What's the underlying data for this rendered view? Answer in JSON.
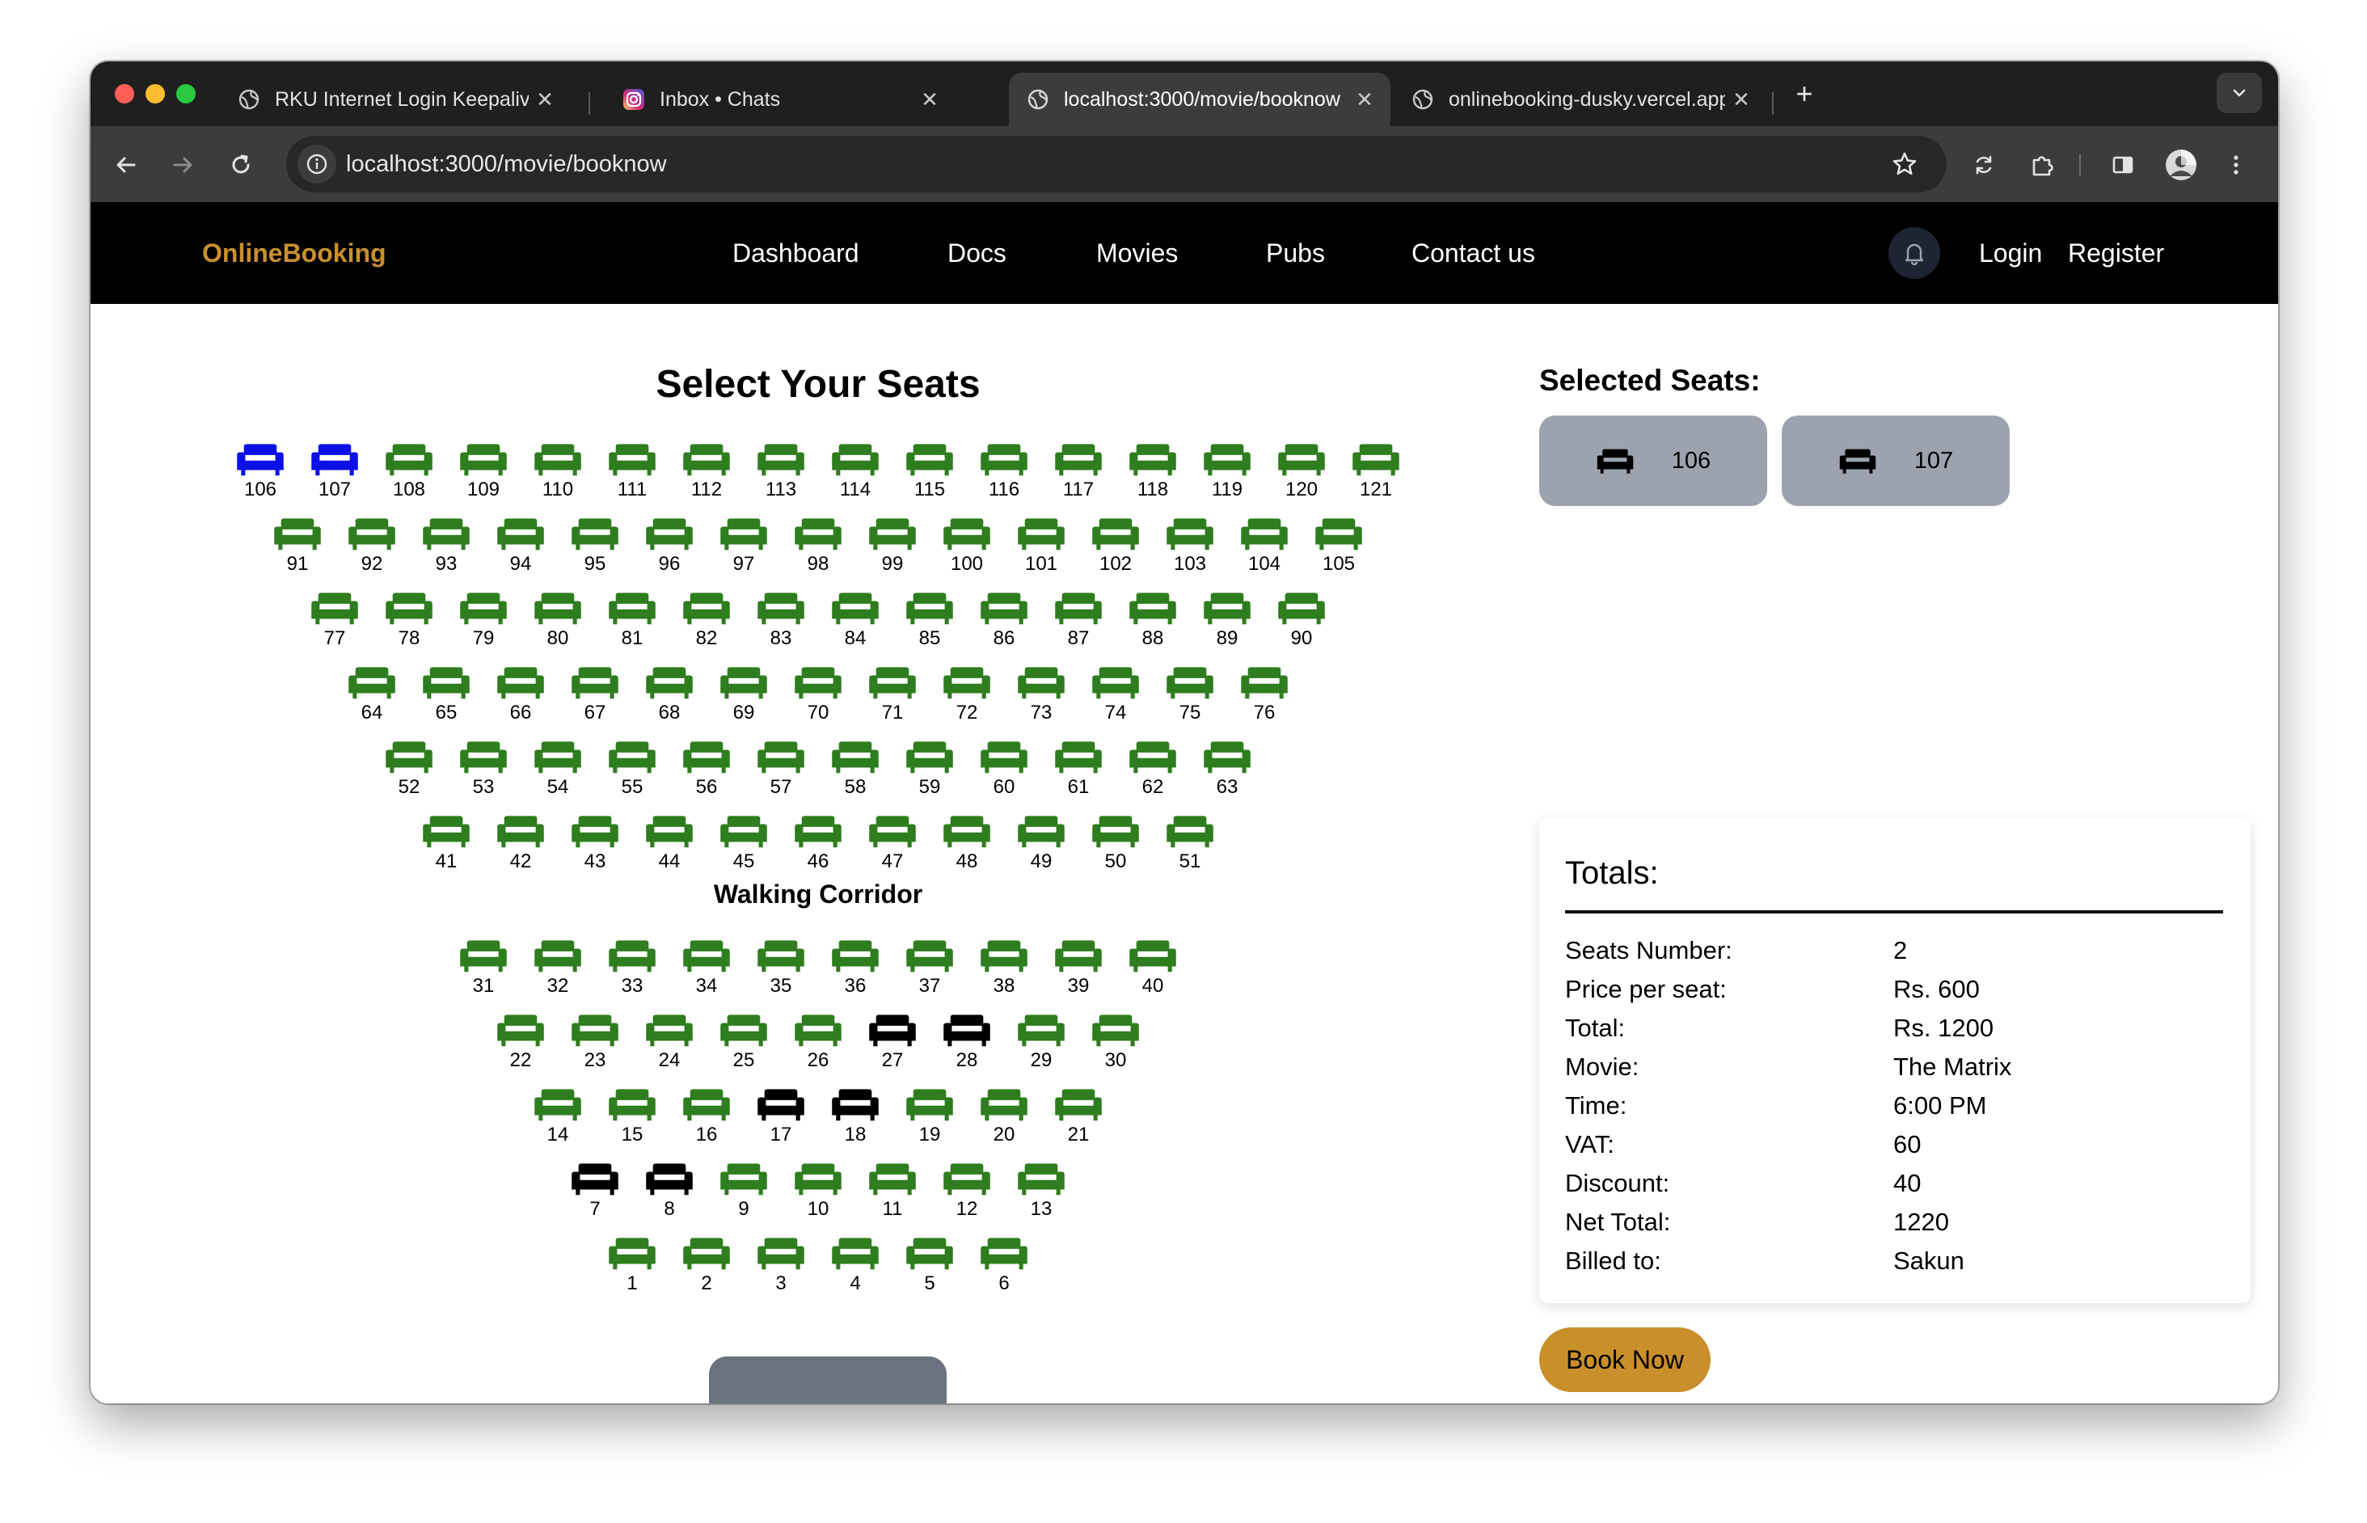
{
  "browser": {
    "tabs": [
      {
        "title": "RKU Internet Login Keepalive",
        "icon": "globe-icon",
        "active": false
      },
      {
        "title": "Inbox • Chats",
        "icon": "instagram-icon",
        "active": false
      },
      {
        "title": "localhost:3000/movie/booknow",
        "icon": "globe-icon",
        "active": true
      },
      {
        "title": "onlinebooking-dusky.vercel.app",
        "icon": "globe-icon",
        "active": false
      }
    ],
    "close_glyph": "✕",
    "new_tab_glyph": "+",
    "url": "localhost:3000/movie/booknow"
  },
  "nav": {
    "brand": "OnlineBooking",
    "links": [
      "Dashboard",
      "Docs",
      "Movies",
      "Pubs",
      "Contact us"
    ],
    "login": "Login",
    "register": "Register"
  },
  "seating": {
    "title": "Select Your Seats",
    "corridor_label": "Walking Corridor",
    "rows_back": [
      [
        "106",
        "107",
        "108",
        "109",
        "110",
        "111",
        "112",
        "113",
        "114",
        "115",
        "116",
        "117",
        "118",
        "119",
        "120",
        "121"
      ],
      [
        "91",
        "92",
        "93",
        "94",
        "95",
        "96",
        "97",
        "98",
        "99",
        "100",
        "101",
        "102",
        "103",
        "104",
        "105"
      ],
      [
        "77",
        "78",
        "79",
        "80",
        "81",
        "82",
        "83",
        "84",
        "85",
        "86",
        "87",
        "88",
        "89",
        "90"
      ],
      [
        "64",
        "65",
        "66",
        "67",
        "68",
        "69",
        "70",
        "71",
        "72",
        "73",
        "74",
        "75",
        "76"
      ],
      [
        "52",
        "53",
        "54",
        "55",
        "56",
        "57",
        "58",
        "59",
        "60",
        "61",
        "62",
        "63"
      ],
      [
        "41",
        "42",
        "43",
        "44",
        "45",
        "46",
        "47",
        "48",
        "49",
        "50",
        "51"
      ]
    ],
    "rows_front": [
      [
        "31",
        "32",
        "33",
        "34",
        "35",
        "36",
        "37",
        "38",
        "39",
        "40"
      ],
      [
        "22",
        "23",
        "24",
        "25",
        "26",
        "27",
        "28",
        "29",
        "30"
      ],
      [
        "14",
        "15",
        "16",
        "17",
        "18",
        "19",
        "20",
        "21"
      ],
      [
        "7",
        "8",
        "9",
        "10",
        "11",
        "12",
        "13"
      ],
      [
        "1",
        "2",
        "3",
        "4",
        "5",
        "6"
      ]
    ],
    "selected": [
      "106",
      "107"
    ],
    "booked": [
      "27",
      "28",
      "17",
      "18",
      "7",
      "8"
    ],
    "colors": {
      "available": "#2e7d1e",
      "selected": "#0b10e6",
      "booked": "#000000"
    }
  },
  "selected_panel": {
    "title": "Selected Seats:",
    "seats": [
      "106",
      "107"
    ]
  },
  "totals": {
    "title": "Totals:",
    "rows": [
      {
        "label": "Seats Number:",
        "value": "2"
      },
      {
        "label": "Price per seat:",
        "value": "Rs. 600"
      },
      {
        "label": "Total:",
        "value": "Rs. 1200"
      },
      {
        "label": "Movie:",
        "value": "The Matrix"
      },
      {
        "label": "Time:",
        "value": "6:00 PM"
      },
      {
        "label": "VAT:",
        "value": "60"
      },
      {
        "label": "Discount:",
        "value": "40"
      },
      {
        "label": "Net Total:",
        "value": "1220"
      },
      {
        "label": "Billed to:",
        "value": "Sakun"
      }
    ]
  },
  "book_button": "Book Now",
  "theme": {
    "brand_color": "#c9902e",
    "button_color": "#c98f2a",
    "chip_color": "#9ca3af"
  }
}
